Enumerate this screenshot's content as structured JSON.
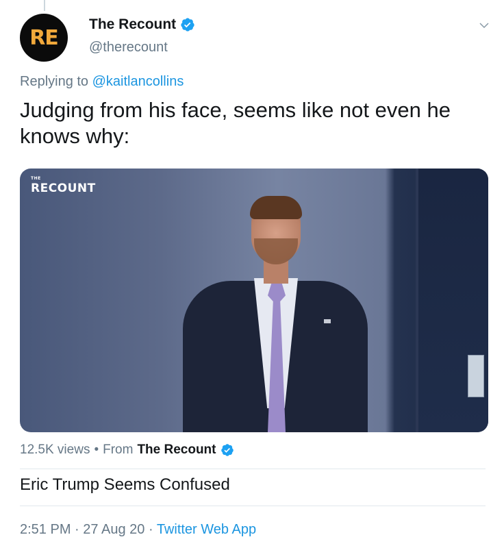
{
  "author": {
    "display_name": "The Recount",
    "handle": "@therecount",
    "avatar_text": "RE",
    "verified": true
  },
  "reply": {
    "prefix": "Replying to",
    "mention": "@kaitlancollins"
  },
  "tweet": {
    "text": "Judging from his face, seems like not even he knows why:"
  },
  "media": {
    "watermark_small": "THE",
    "watermark": "RECOUNT"
  },
  "video_meta": {
    "views": "12.5K views",
    "separator": "•",
    "from_label": "From",
    "from_name": "The Recount"
  },
  "video_title": "Eric Trump Seems Confused",
  "footer": {
    "time": "2:51 PM",
    "dot1": "·",
    "date": "27 Aug 20",
    "dot2": "·",
    "app": "Twitter Web App"
  },
  "colors": {
    "link": "#1b95e0",
    "secondary_text": "#657786",
    "avatar_bg": "#0b0b0b",
    "avatar_text": "#f2a93b"
  },
  "icons": [
    "verified-badge-icon",
    "chevron-down-icon"
  ]
}
